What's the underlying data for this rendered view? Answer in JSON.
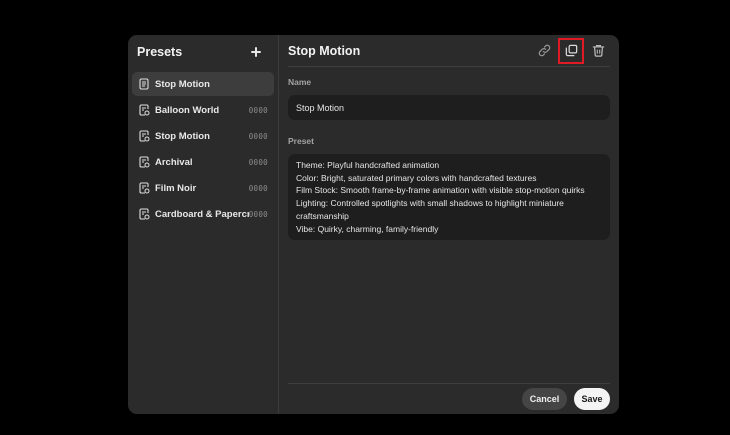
{
  "sidebar": {
    "title": "Presets",
    "add_icon": "plus-icon",
    "items": [
      {
        "label": "Stop Motion",
        "code": "",
        "active": true,
        "icon": "preset-doc-icon"
      },
      {
        "label": "Balloon World",
        "code": "0000",
        "active": false,
        "icon": "preset-doc-edit-icon"
      },
      {
        "label": "Stop Motion",
        "code": "0000",
        "active": false,
        "icon": "preset-doc-edit-icon"
      },
      {
        "label": "Archival",
        "code": "0000",
        "active": false,
        "icon": "preset-doc-edit-icon"
      },
      {
        "label": "Film Noir",
        "code": "0000",
        "active": false,
        "icon": "preset-doc-edit-icon"
      },
      {
        "label": "Cardboard & Papercraft",
        "code": "0000",
        "active": false,
        "icon": "preset-doc-edit-icon"
      }
    ]
  },
  "main": {
    "title": "Stop Motion",
    "actions": [
      {
        "icon": "link-icon"
      },
      {
        "icon": "duplicate-icon"
      },
      {
        "icon": "trash-icon"
      }
    ],
    "name_label": "Name",
    "name_value": "Stop Motion",
    "preset_label": "Preset",
    "preset_text": "Theme: Playful handcrafted animation\nColor: Bright, saturated primary colors with handcrafted textures\nFilm Stock: Smooth frame-by-frame animation with visible stop-motion quirks\nLighting: Controlled spotlights with small shadows to highlight miniature craftsmanship\nVibe: Quirky, charming, family-friendly"
  },
  "footer": {
    "cancel_label": "Cancel",
    "save_label": "Save"
  },
  "colors": {
    "highlight": "#e01b24",
    "panel": "#2b2b2b",
    "field": "#1e1e1e"
  }
}
